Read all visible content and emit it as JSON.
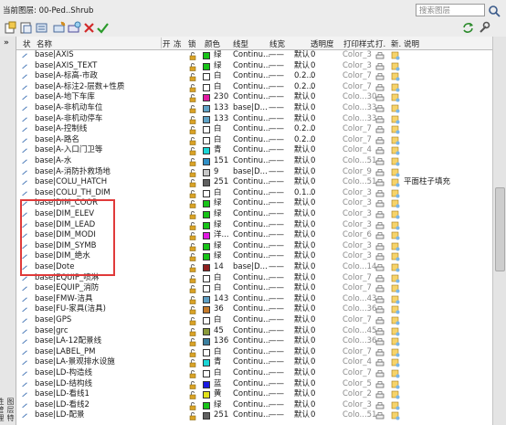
{
  "header": {
    "current_layer_label": "当前图层: 00-Ped..Shrub",
    "search_placeholder": "搜索图层"
  },
  "side_vertical_text": "图层特性管理器",
  "columns": {
    "status": "状",
    "name": "名称",
    "on": "开",
    "freeze": "冻",
    "lock": "锁",
    "color": "颜色",
    "linetype": "线型",
    "lineweight": "线宽",
    "transparency": "透明度",
    "plotstyle": "打印样式",
    "plot": "打.",
    "newvp": "新.",
    "description": "说明"
  },
  "layers": [
    {
      "name": "base|AXIS",
      "color_name": "绿",
      "color_hex": "#18c418",
      "linetype": "Continu...",
      "lineweight": "默认",
      "transparency": "0",
      "plot_style": "Color_3",
      "description": ""
    },
    {
      "name": "base|AXIS_TEXT",
      "color_name": "绿",
      "color_hex": "#18c418",
      "linetype": "Continu...",
      "lineweight": "默认",
      "transparency": "0",
      "plot_style": "Color_3",
      "description": ""
    },
    {
      "name": "base|A-标高-市政",
      "color_name": "白",
      "color_hex": "#ffffff",
      "linetype": "Continu...",
      "lineweight": "0.2...",
      "transparency": "0",
      "plot_style": "Color_7",
      "description": ""
    },
    {
      "name": "base|A-标注2-层数+性质",
      "color_name": "白",
      "color_hex": "#ffffff",
      "linetype": "Continu...",
      "lineweight": "0.2...",
      "transparency": "0",
      "plot_style": "Color_7",
      "description": ""
    },
    {
      "name": "base|A-地下车库",
      "color_name": "230",
      "color_hex": "#e21aa3",
      "linetype": "Continu...",
      "lineweight": "默认",
      "transparency": "0",
      "plot_style": "Colo...30",
      "description": ""
    },
    {
      "name": "base|A-非机动车位",
      "color_name": "133",
      "color_hex": "#5fa3c7",
      "linetype": "base|D...",
      "lineweight": "默认",
      "transparency": "0",
      "plot_style": "Colo...33",
      "description": ""
    },
    {
      "name": "base|A-非机动停车",
      "color_name": "133",
      "color_hex": "#5fa3c7",
      "linetype": "Continu...",
      "lineweight": "默认",
      "transparency": "0",
      "plot_style": "Colo...33",
      "description": ""
    },
    {
      "name": "base|A-控制线",
      "color_name": "白",
      "color_hex": "#ffffff",
      "linetype": "Continu...",
      "lineweight": "0.2...",
      "transparency": "0",
      "plot_style": "Color_7",
      "description": ""
    },
    {
      "name": "base|A-路名",
      "color_name": "白",
      "color_hex": "#ffffff",
      "linetype": "Continu...",
      "lineweight": "0.2...",
      "transparency": "0",
      "plot_style": "Color_7",
      "description": ""
    },
    {
      "name": "base|A-入口门卫等",
      "color_name": "青",
      "color_hex": "#1ad6d6",
      "linetype": "Continu...",
      "lineweight": "默认",
      "transparency": "0",
      "plot_style": "Color_4",
      "description": ""
    },
    {
      "name": "base|A-水",
      "color_name": "151",
      "color_hex": "#2f8fc6",
      "linetype": "Continu...",
      "lineweight": "默认",
      "transparency": "0",
      "plot_style": "Colo...51",
      "description": ""
    },
    {
      "name": "base|A-消防扑救场地",
      "color_name": "9",
      "color_hex": "#c9c9c9",
      "linetype": "base|D...",
      "lineweight": "默认",
      "transparency": "0",
      "plot_style": "Color_9",
      "description": ""
    },
    {
      "name": "base|COLU_HATCH",
      "color_name": "251",
      "color_hex": "#616161",
      "linetype": "Continu...",
      "lineweight": "默认",
      "transparency": "0",
      "plot_style": "Colo...51",
      "description": "平面柱子填充"
    },
    {
      "name": "base|COLU_TH_DIM",
      "color_name": "白",
      "color_hex": "#ffffff",
      "linetype": "Continu...",
      "lineweight": "0.1...",
      "transparency": "0",
      "plot_style": "Color_3",
      "description": ""
    },
    {
      "name": "base|DIM_COOR",
      "color_name": "绿",
      "color_hex": "#18c418",
      "linetype": "Continu...",
      "lineweight": "默认",
      "transparency": "0",
      "plot_style": "Color_3",
      "description": ""
    },
    {
      "name": "base|DIM_ELEV",
      "color_name": "绿",
      "color_hex": "#18c418",
      "linetype": "Continu...",
      "lineweight": "默认",
      "transparency": "0",
      "plot_style": "Color_3",
      "description": ""
    },
    {
      "name": "base|DIM_LEAD",
      "color_name": "绿",
      "color_hex": "#18c418",
      "linetype": "Continu...",
      "lineweight": "默认",
      "transparency": "0",
      "plot_style": "Color_3",
      "description": ""
    },
    {
      "name": "base|DIM_MODI",
      "color_name": "洋...",
      "color_hex": "#e21ae2",
      "linetype": "Continu...",
      "lineweight": "默认",
      "transparency": "0",
      "plot_style": "Color_6",
      "description": ""
    },
    {
      "name": "base|DIM_SYMB",
      "color_name": "绿",
      "color_hex": "#18c418",
      "linetype": "Continu...",
      "lineweight": "默认",
      "transparency": "0",
      "plot_style": "Color_3",
      "description": ""
    },
    {
      "name": "base|DIM_绝水",
      "color_name": "绿",
      "color_hex": "#18c418",
      "linetype": "Continu...",
      "lineweight": "默认",
      "transparency": "0",
      "plot_style": "Color_3",
      "description": ""
    },
    {
      "name": "base|Dote",
      "color_name": "14",
      "color_hex": "#8f1f1f",
      "linetype": "base|D...",
      "lineweight": "默认",
      "transparency": "0",
      "plot_style": "Colo...14",
      "description": ""
    },
    {
      "name": "base|EQUIP_喷淋",
      "color_name": "白",
      "color_hex": "#ffffff",
      "linetype": "Continu...",
      "lineweight": "默认",
      "transparency": "0",
      "plot_style": "Color_7",
      "description": ""
    },
    {
      "name": "base|EQUIP_消防",
      "color_name": "白",
      "color_hex": "#ffffff",
      "linetype": "Continu...",
      "lineweight": "默认",
      "transparency": "0",
      "plot_style": "Color_7",
      "description": ""
    },
    {
      "name": "base|FMW-洁具",
      "color_name": "143",
      "color_hex": "#5e9fc4",
      "linetype": "Continu...",
      "lineweight": "默认",
      "transparency": "0",
      "plot_style": "Colo...43",
      "description": ""
    },
    {
      "name": "base|FU-家具(洁具)",
      "color_name": "36",
      "color_hex": "#c47a2a",
      "linetype": "Continu...",
      "lineweight": "默认",
      "transparency": "0",
      "plot_style": "Colo...36",
      "description": ""
    },
    {
      "name": "base|GPS",
      "color_name": "白",
      "color_hex": "#ffffff",
      "linetype": "Continu...",
      "lineweight": "默认",
      "transparency": "0",
      "plot_style": "Color_7",
      "description": ""
    },
    {
      "name": "base|grc",
      "color_name": "45",
      "color_hex": "#8a9a3a",
      "linetype": "Continu...",
      "lineweight": "默认",
      "transparency": "0",
      "plot_style": "Colo...45",
      "description": ""
    },
    {
      "name": "base|LA-12配景线",
      "color_name": "136",
      "color_hex": "#3a7f9f",
      "linetype": "Continu...",
      "lineweight": "默认",
      "transparency": "0",
      "plot_style": "Colo...36",
      "description": ""
    },
    {
      "name": "base|LABEL_PM",
      "color_name": "白",
      "color_hex": "#ffffff",
      "linetype": "Continu...",
      "lineweight": "默认",
      "transparency": "0",
      "plot_style": "Color_7",
      "description": ""
    },
    {
      "name": "base|LA-景观排水设施",
      "color_name": "青",
      "color_hex": "#1ad6d6",
      "linetype": "Continu...",
      "lineweight": "默认",
      "transparency": "0",
      "plot_style": "Color_4",
      "description": ""
    },
    {
      "name": "base|LD-构造线",
      "color_name": "白",
      "color_hex": "#ffffff",
      "linetype": "Continu...",
      "lineweight": "默认",
      "transparency": "0",
      "plot_style": "Color_7",
      "description": ""
    },
    {
      "name": "base|LD-结构线",
      "color_name": "蓝",
      "color_hex": "#1a1ae2",
      "linetype": "Continu...",
      "lineweight": "默认",
      "transparency": "0",
      "plot_style": "Color_5",
      "description": ""
    },
    {
      "name": "base|LD-看线1",
      "color_name": "黄",
      "color_hex": "#e2e21a",
      "linetype": "Continu...",
      "lineweight": "默认",
      "transparency": "0",
      "plot_style": "Color_2",
      "description": ""
    },
    {
      "name": "base|LD-看线2",
      "color_name": "绿",
      "color_hex": "#18c418",
      "linetype": "Continu...",
      "lineweight": "默认",
      "transparency": "0",
      "plot_style": "Color_3",
      "description": ""
    },
    {
      "name": "base|LD-配景",
      "color_name": "251",
      "color_hex": "#616161",
      "linetype": "Continu...",
      "lineweight": "默认",
      "transparency": "0",
      "plot_style": "Colo...51",
      "description": ""
    }
  ]
}
